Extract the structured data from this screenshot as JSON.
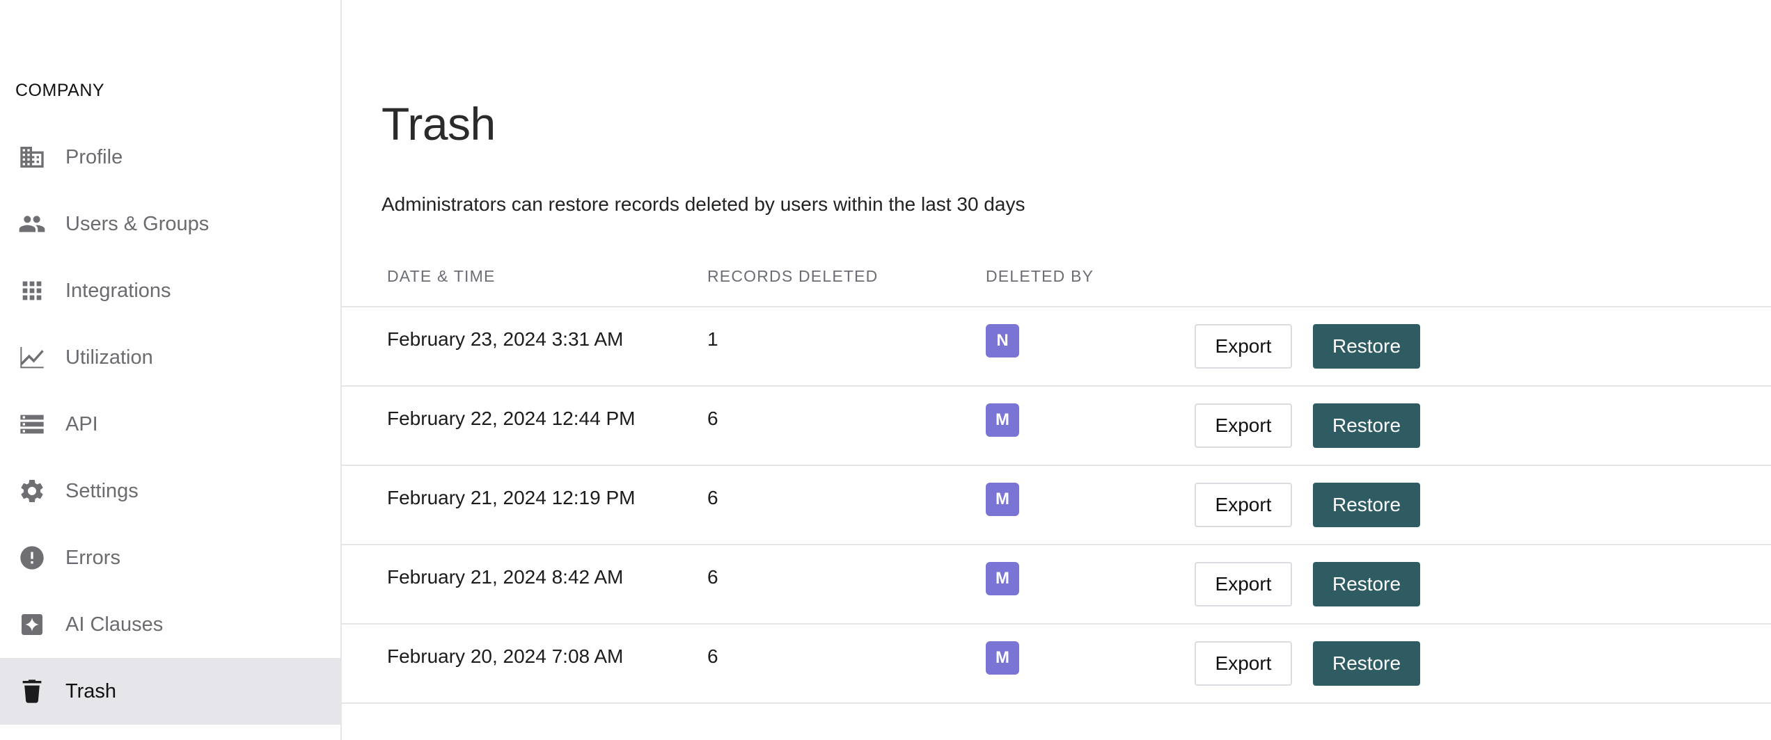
{
  "sidebar": {
    "section_label": "COMPANY",
    "items": [
      {
        "label": "Profile",
        "icon": "building-icon",
        "active": false
      },
      {
        "label": "Users & Groups",
        "icon": "users-icon",
        "active": false
      },
      {
        "label": "Integrations",
        "icon": "grid-icon",
        "active": false
      },
      {
        "label": "Utilization",
        "icon": "line-chart-icon",
        "active": false
      },
      {
        "label": "API",
        "icon": "server-list-icon",
        "active": false
      },
      {
        "label": "Settings",
        "icon": "gear-icon",
        "active": false
      },
      {
        "label": "Errors",
        "icon": "alert-circle-icon",
        "active": false
      },
      {
        "label": "AI Clauses",
        "icon": "sparkle-icon",
        "active": false
      },
      {
        "label": "Trash",
        "icon": "trash-icon",
        "active": true
      }
    ]
  },
  "main": {
    "title": "Trash",
    "subtitle": "Administrators can restore records deleted by users within the last 30 days",
    "table": {
      "headers": {
        "date_time": "DATE & TIME",
        "records_deleted": "RECORDS DELETED",
        "deleted_by": "DELETED BY"
      },
      "rows": [
        {
          "date_time": "February 23, 2024 3:31 AM",
          "records_deleted": "1",
          "deleted_by": "N",
          "export_label": "Export",
          "restore_label": "Restore"
        },
        {
          "date_time": "February 22, 2024 12:44 PM",
          "records_deleted": "6",
          "deleted_by": "M",
          "export_label": "Export",
          "restore_label": "Restore"
        },
        {
          "date_time": "February 21, 2024 12:19 PM",
          "records_deleted": "6",
          "deleted_by": "M",
          "export_label": "Export",
          "restore_label": "Restore"
        },
        {
          "date_time": "February 21, 2024 8:42 AM",
          "records_deleted": "6",
          "deleted_by": "M",
          "export_label": "Export",
          "restore_label": "Restore"
        },
        {
          "date_time": "February 20, 2024 7:08 AM",
          "records_deleted": "6",
          "deleted_by": "M",
          "export_label": "Export",
          "restore_label": "Restore"
        }
      ]
    }
  },
  "colors": {
    "avatar": "#7a74d4",
    "restore_button": "#2f5b62",
    "active_sidebar": "#e6e6ea"
  }
}
